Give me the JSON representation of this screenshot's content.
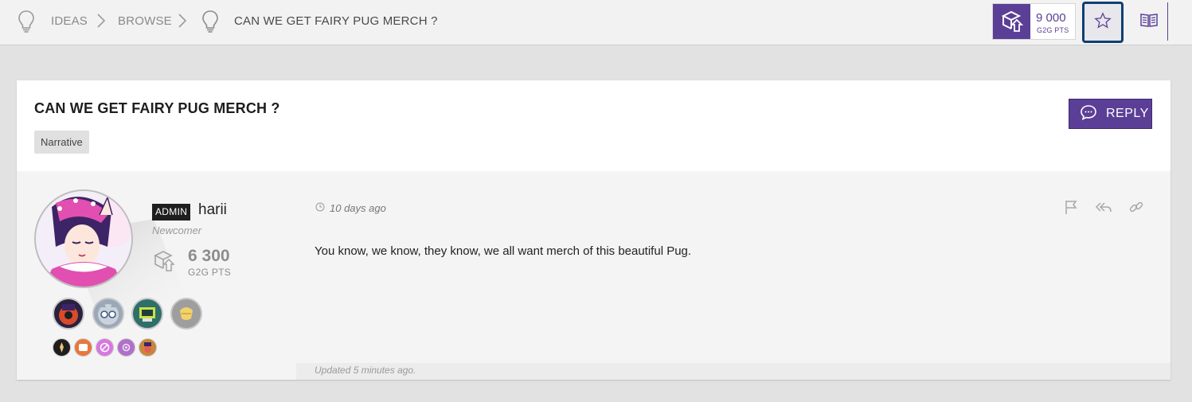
{
  "breadcrumb": {
    "items": [
      {
        "label": "IDEAS"
      },
      {
        "label": "BROWSE"
      },
      {
        "label": "CAN WE GET FAIRY PUG MERCH ?"
      }
    ]
  },
  "header": {
    "points": {
      "value": "9 000",
      "unit": "G2G PTS"
    }
  },
  "topic": {
    "title": "CAN WE GET FAIRY PUG MERCH ?",
    "tag": "Narrative",
    "reply_label": "REPLY"
  },
  "post": {
    "author": {
      "role_badge": "ADMIN",
      "name": "harii",
      "rank": "Newcomer",
      "points": "6 300",
      "points_unit": "G2G PTS"
    },
    "timestamp": "10 days ago",
    "body": "You know, we know, they know, we all want merch of this beautiful Pug.",
    "updated": "Updated 5 minutes ago."
  },
  "colors": {
    "accent": "#5b3f97",
    "focus_outline": "#0f3e74",
    "admin_badge": "#1e1e1e"
  },
  "icons": {
    "breadcrumb": "lightbulb-icon",
    "points": "g2g-logo-icon",
    "favorite": "star-icon",
    "guide": "book-icon",
    "reply": "chat-bubble-icon",
    "flag": "flag-icon",
    "reply_to_post": "reply-all-icon",
    "permalink": "link-icon",
    "clock": "clock-icon"
  }
}
